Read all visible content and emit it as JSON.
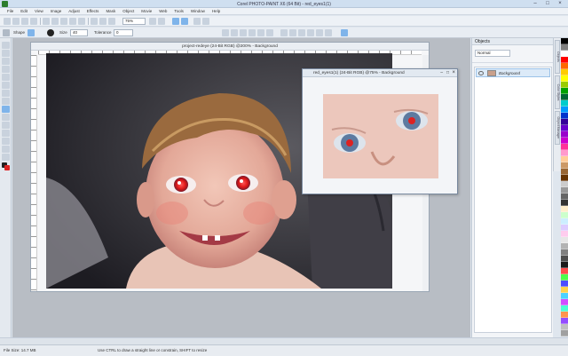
{
  "window": {
    "title": "Corel PHOTO-PAINT X6 (64 Bit) - red_eyes1(1)"
  },
  "menu": [
    "File",
    "Edit",
    "View",
    "Image",
    "Adjust",
    "Effects",
    "Mask",
    "Object",
    "Movie",
    "Web",
    "Tools",
    "Window",
    "Help"
  ],
  "toolbar": {
    "zoom_value": "75%"
  },
  "property_bar": {
    "shape_label": "Shape",
    "size_label": "Size",
    "size_value": "40",
    "tolerance_label": "Tolerance",
    "tolerance_value": "0"
  },
  "document": {
    "title": "project-redeye (24-Bit RGB) @200% - Background"
  },
  "secondary_window": {
    "title": "red_eyes1(1) (24-Bit RGB) @75% - Background"
  },
  "workspace": {
    "hint": "Drag colors (or objects) here to store these colors with your image"
  },
  "objects_panel": {
    "title": "Objects",
    "mode": "Normal",
    "layer_name": "Background"
  },
  "side_tabs": [
    "Objects",
    "Color Styles",
    "Object Manager"
  ],
  "status": {
    "file_size": "File Size: 14.7 MB",
    "hint": "Use CTRL to draw a straight line or constrain, SHIFT to resize"
  },
  "colors": {
    "accent": "#7fb4ea",
    "palette": [
      "#000000",
      "#7f7f7f",
      "#ffffff",
      "#ff0000",
      "#ff6600",
      "#ffcc00",
      "#ffff00",
      "#99cc00",
      "#00a000",
      "#006633",
      "#00cccc",
      "#0099ff",
      "#0033cc",
      "#330099",
      "#6600cc",
      "#9900cc",
      "#cc00cc",
      "#ff3399",
      "#ff99cc",
      "#ffcc99",
      "#cc9966",
      "#996633",
      "#663300",
      "#cccccc",
      "#999999",
      "#666666",
      "#333333",
      "#ffeecc",
      "#ccffcc",
      "#cceeff",
      "#ddccff",
      "#ffccee",
      "#e6e6e6",
      "#b3b3b3",
      "#808080",
      "#4d4d4d",
      "#1a1a1a",
      "#ff4d4d",
      "#4dff4d",
      "#4d4dff",
      "#ffd24d",
      "#4dd2ff",
      "#d24dff",
      "#4dffd2",
      "#ff944d",
      "#944dff",
      "#c0c0c0",
      "#a0a0a0"
    ]
  }
}
